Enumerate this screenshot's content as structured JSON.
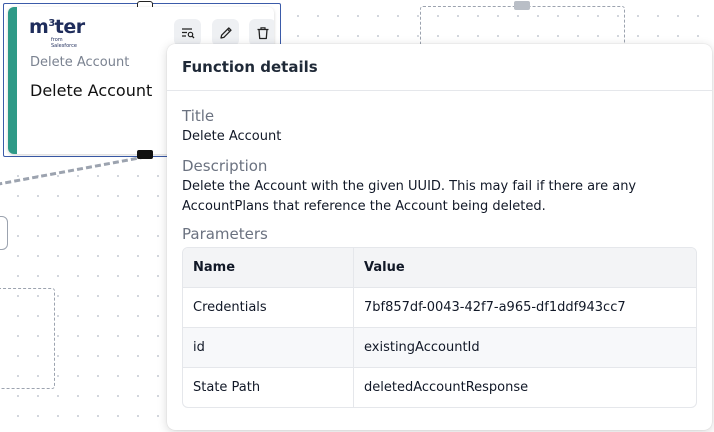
{
  "node": {
    "logo": {
      "main": "m",
      "sup": "3",
      "rest": "ter",
      "sub": "from Salesforce"
    },
    "subtitle": "Delete Account",
    "title": "Delete Account",
    "toolbar": [
      {
        "icon": "details-list-icon"
      },
      {
        "icon": "pencil-icon"
      },
      {
        "icon": "trash-icon"
      }
    ]
  },
  "panel": {
    "header": "Function details",
    "title_label": "Title",
    "title_value": "Delete Account",
    "description_label": "Description",
    "description_value": "Delete the Account with the given UUID. This may fail if there are any AccountPlans that reference the Account being deleted.",
    "parameters_label": "Parameters",
    "columns": [
      "Name",
      "Value"
    ],
    "rows": [
      {
        "name": "Credentials",
        "value": "7bf857df-0043-42f7-a965-df1ddf943cc7"
      },
      {
        "name": "id",
        "value": "existingAccountId"
      },
      {
        "name": "State Path",
        "value": "deletedAccountResponse"
      }
    ]
  },
  "colors": {
    "accent_stripe": "#2f9a87",
    "selection_border": "#3b5ba9",
    "logo": "#1f2d5c"
  }
}
